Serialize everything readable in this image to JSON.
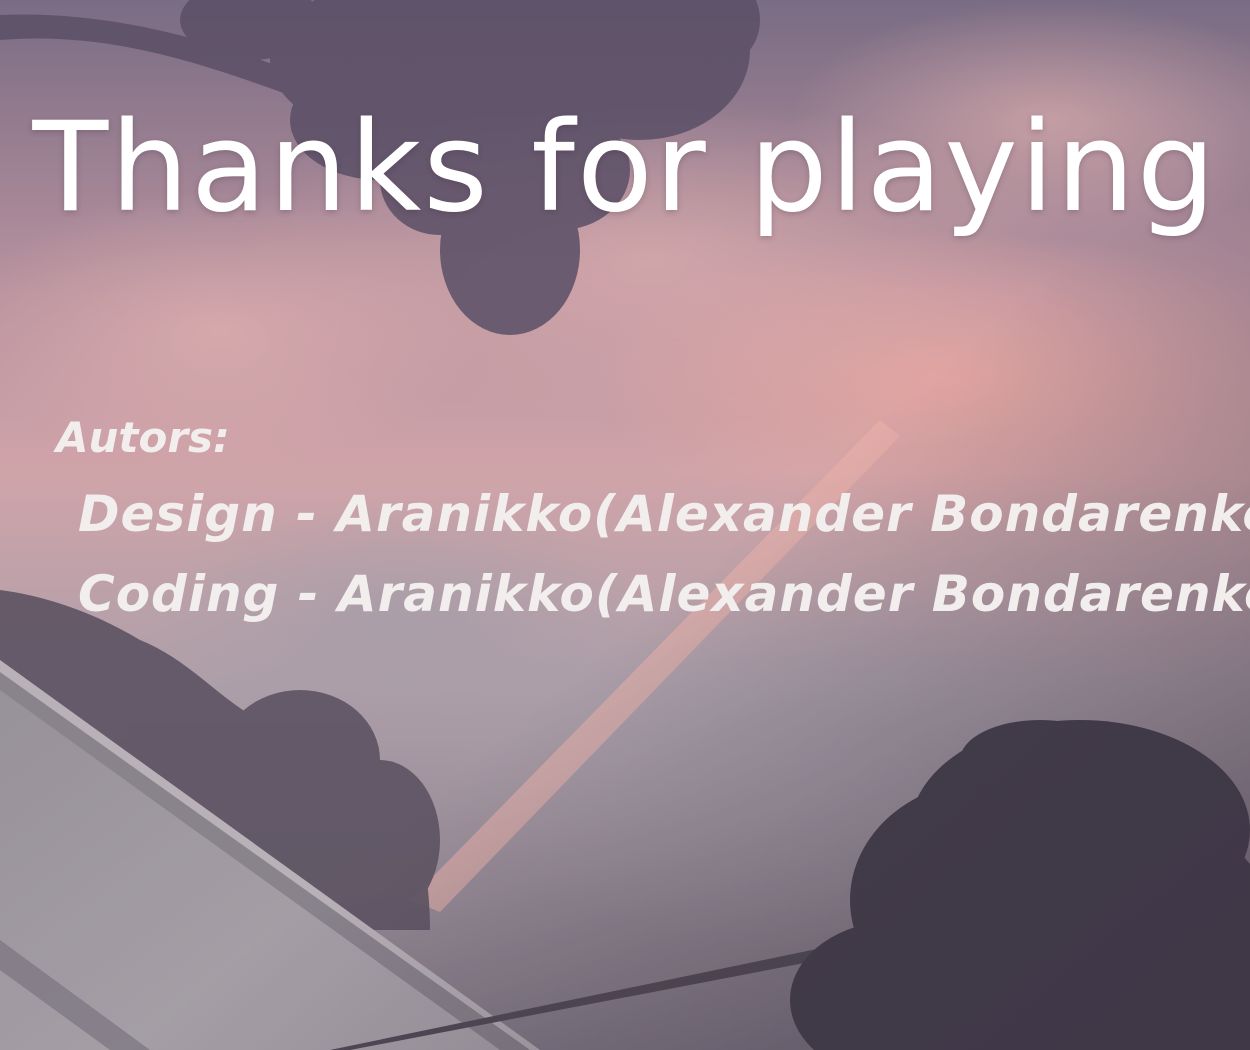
{
  "screen": {
    "title": "Thanks for playing",
    "credits": {
      "heading": "Autors:",
      "lines": [
        "Design - Aranikko(Alexander Bondarenko)",
        "Coding - Aranikko(Alexander Bondarenko)"
      ]
    }
  },
  "colors": {
    "text": "#ffffff",
    "sky_top": "#6a5d78",
    "sky_glow": "#e3a7a2",
    "sky_bottom": "#8a8490",
    "silhouette": "#3f3748"
  }
}
